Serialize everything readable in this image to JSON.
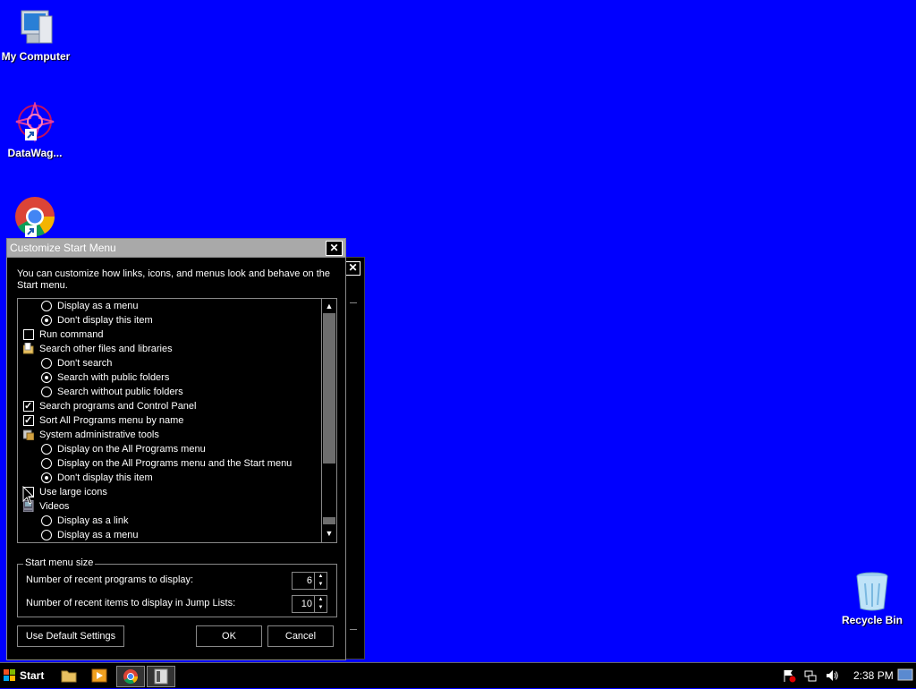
{
  "desktop": {
    "icons": [
      {
        "label": "My Computer"
      },
      {
        "label": "DataWag..."
      },
      {
        "label": ""
      },
      {
        "label": "Recycle Bin"
      }
    ]
  },
  "dialog": {
    "title": "Customize Start Menu",
    "description": "You can customize how links, icons, and menus look and behave on the Start menu.",
    "items": [
      {
        "type": "radio",
        "checked": false,
        "label": "Display as a menu"
      },
      {
        "type": "radio",
        "checked": true,
        "label": "Don't display this item"
      },
      {
        "type": "check",
        "checked": false,
        "label": "Run command"
      },
      {
        "type": "folder",
        "label": "Search other files and libraries"
      },
      {
        "type": "radio",
        "checked": false,
        "label": "Don't search"
      },
      {
        "type": "radio",
        "checked": true,
        "label": "Search with public folders"
      },
      {
        "type": "radio",
        "checked": false,
        "label": "Search without public folders"
      },
      {
        "type": "check",
        "checked": true,
        "label": "Search programs and Control Panel"
      },
      {
        "type": "check",
        "checked": true,
        "label": "Sort All Programs menu by name"
      },
      {
        "type": "tools",
        "label": "System administrative tools"
      },
      {
        "type": "radio",
        "checked": false,
        "label": "Display on the All Programs menu"
      },
      {
        "type": "radio",
        "checked": false,
        "label": "Display on the All Programs menu and the Start menu"
      },
      {
        "type": "radio",
        "checked": true,
        "label": "Don't display this item"
      },
      {
        "type": "check",
        "checked": false,
        "label": "Use large icons"
      },
      {
        "type": "video",
        "label": "Videos"
      },
      {
        "type": "radio",
        "checked": false,
        "label": "Display as a link"
      },
      {
        "type": "radio",
        "checked": false,
        "label": "Display as a menu"
      }
    ],
    "size_group": {
      "legend": "Start menu size",
      "recent_programs_label": "Number of recent programs to display:",
      "recent_programs_value": "6",
      "jump_list_label": "Number of recent items to display in Jump Lists:",
      "jump_list_value": "10"
    },
    "buttons": {
      "default": "Use Default Settings",
      "ok": "OK",
      "cancel": "Cancel"
    }
  },
  "taskbar": {
    "start_label": "Start",
    "clock": "2:38 PM"
  },
  "colors": {
    "desktop": "#0000ff",
    "dialog_bg": "#000000",
    "titlebar": "#a9a9a9"
  }
}
